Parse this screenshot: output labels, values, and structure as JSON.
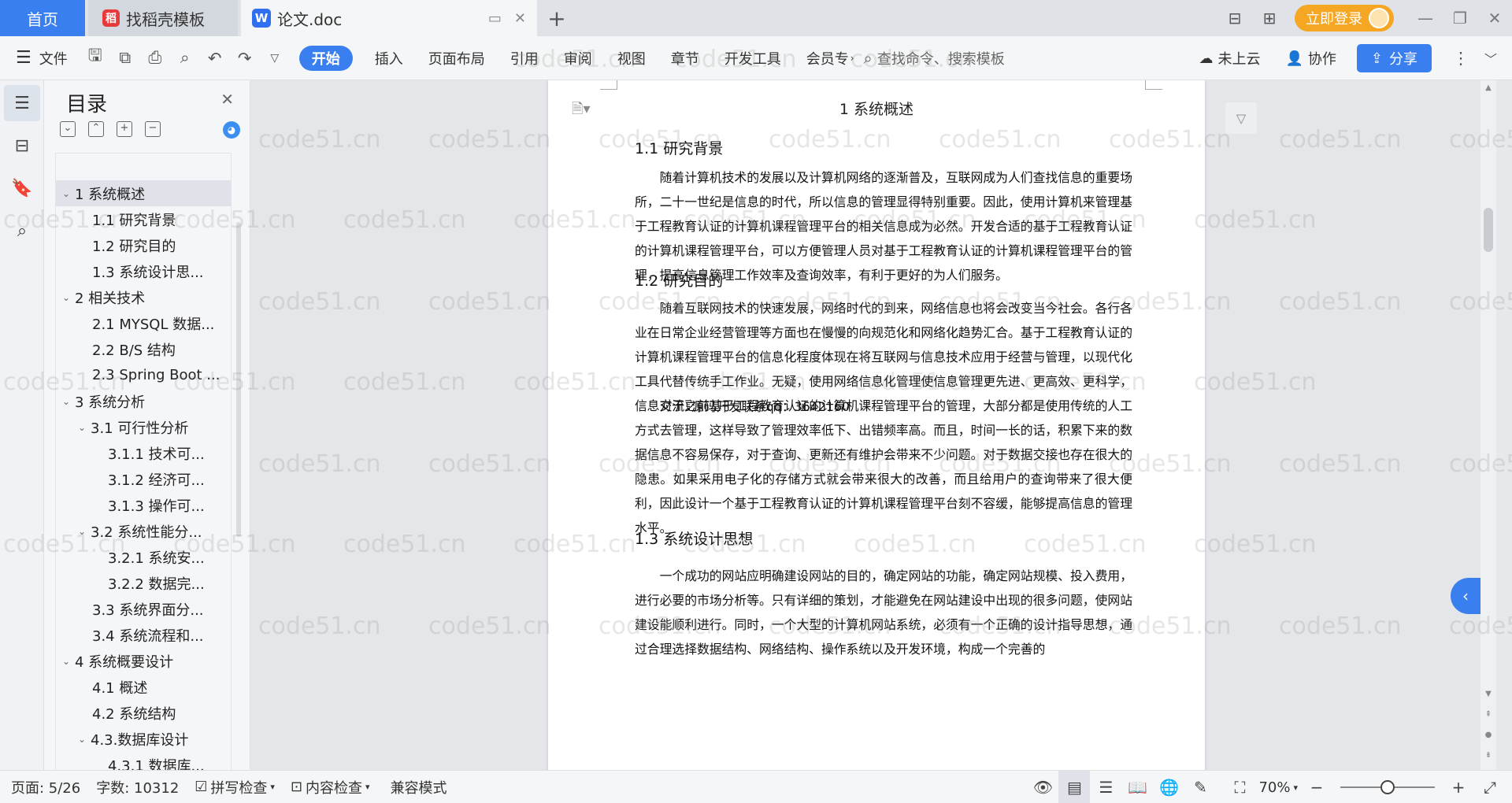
{
  "tabbar": {
    "home_label": "首页",
    "template_tab": "找稻壳模板",
    "doc_tab": "论文.doc",
    "login_button": "立即登录"
  },
  "ribbon": {
    "file_menu": "文件",
    "tabs": [
      "开始",
      "插入",
      "页面布局",
      "引用",
      "审阅",
      "视图",
      "章节",
      "开发工具",
      "会员专"
    ],
    "search_placeholder": "查找命令、搜索模板",
    "cloud_status": "未上云",
    "collaborate": "协作",
    "share": "分享"
  },
  "toc": {
    "title": "目录",
    "items": [
      {
        "label": "1 系统概述",
        "level": 1,
        "chevron": true,
        "selected": true
      },
      {
        "label": "1.1  研究背景",
        "level": 2,
        "chevron": false
      },
      {
        "label": "1.2 研究目的",
        "level": 2,
        "chevron": false
      },
      {
        "label": "1.3 系统设计思...",
        "level": 2,
        "chevron": false
      },
      {
        "label": "2 相关技术",
        "level": 1,
        "chevron": true
      },
      {
        "label": "2.1 MYSQL 数据...",
        "level": 2,
        "chevron": false
      },
      {
        "label": "2.2 B/S 结构",
        "level": 2,
        "chevron": false
      },
      {
        "label": "2.3 Spring Boot ...",
        "level": 2,
        "chevron": false
      },
      {
        "label": "3 系统分析",
        "level": 1,
        "chevron": true
      },
      {
        "label": "3.1 可行性分析",
        "level": 2,
        "chevron": true
      },
      {
        "label": "3.1.1 技术可...",
        "level": 3,
        "chevron": false
      },
      {
        "label": "3.1.2 经济可...",
        "level": 3,
        "chevron": false
      },
      {
        "label": "3.1.3 操作可...",
        "level": 3,
        "chevron": false
      },
      {
        "label": "3.2 系统性能分...",
        "level": 2,
        "chevron": true
      },
      {
        "label": "3.2.1  系统安...",
        "level": 3,
        "chevron": false
      },
      {
        "label": "3.2.2  数据完...",
        "level": 3,
        "chevron": false
      },
      {
        "label": "3.3 系统界面分...",
        "level": 2,
        "chevron": false
      },
      {
        "label": "3.4 系统流程和...",
        "level": 2,
        "chevron": false
      },
      {
        "label": "4 系统概要设计",
        "level": 1,
        "chevron": true
      },
      {
        "label": "4.1 概述",
        "level": 2,
        "chevron": false
      },
      {
        "label": "4.2 系统结构",
        "level": 2,
        "chevron": false
      },
      {
        "label": "4.3.数据库设计",
        "level": 2,
        "chevron": true
      },
      {
        "label": "4.3.1 数据库...",
        "level": 3,
        "chevron": false
      }
    ]
  },
  "document": {
    "chapter_title": "1 系统概述",
    "s1_heading": "1.1  研究背景",
    "s1_para": "随着计算机技术的发展以及计算机网络的逐渐普及，互联网成为人们查找信息的重要场所，二十一世纪是信息的时代，所以信息的管理显得特别重要。因此，使用计算机来管理基于工程教育认证的计算机课程管理平台的相关信息成为必然。开发合适的基于工程教育认证的计算机课程管理平台，可以方便管理人员对基于工程教育认证的计算机课程管理平台的管理，提高信息管理工作效率及查询效率，有利于更好的为人们服务。",
    "s2_heading": "1.2 研究目的",
    "s2_para1": "随着互联网技术的快速发展，网络时代的到来，网络信息也将会改变当今社会。各行各业在日常企业经营管理等方面也在慢慢的向规范化和网络化趋势汇合。基于工程教育认证的计算机课程管理平台的信息化程度体现在将互联网与信息技术应用于经营与管理，以现代化工具代替传统手工作业。无疑，使用网络信息化管理使信息管理更先进、更高效、更科学，信息交流更迅速。",
    "s2_overlay": "源码开发联系qq：3642160",
    "s2_para2": "对于之前基于工程教育认证的计算机课程管理平台的管理，大部分都是使用传统的人工方式去管理，这样导致了管理效率低下、出错频率高。而且，时间一长的话，积累下来的数据信息不容易保存，对于查询、更新还有维护会带来不少问题。对于数据交接也存在很大的隐患。如果采用电子化的存储方式就会带来很大的改善，而且给用户的查询带来了很大便利，因此设计一个基于工程教育认证的计算机课程管理平台刻不容缓，能够提高信息的管理水平。",
    "s3_heading": "1.3 系统设计思想",
    "s3_para": "一个成功的网站应明确建设网站的目的，确定网站的功能，确定网站规模、投入费用，进行必要的市场分析等。只有详细的策划，才能避免在网站建设中出现的很多问题，使网站建设能顺利进行。同时，一个大型的计算机网站系统，必须有一个正确的设计指导思想，通过合理选择数据结构、网络结构、操作系统以及开发环境，构成一个完善的"
  },
  "status": {
    "page": "页面: 5/26",
    "words": "字数: 10312",
    "spell_check": "拼写检查",
    "content_check": "内容检查",
    "compat_mode": "兼容模式",
    "zoom": "70%",
    "zoom_fraction": 0.5
  },
  "watermark": "code51.cn"
}
